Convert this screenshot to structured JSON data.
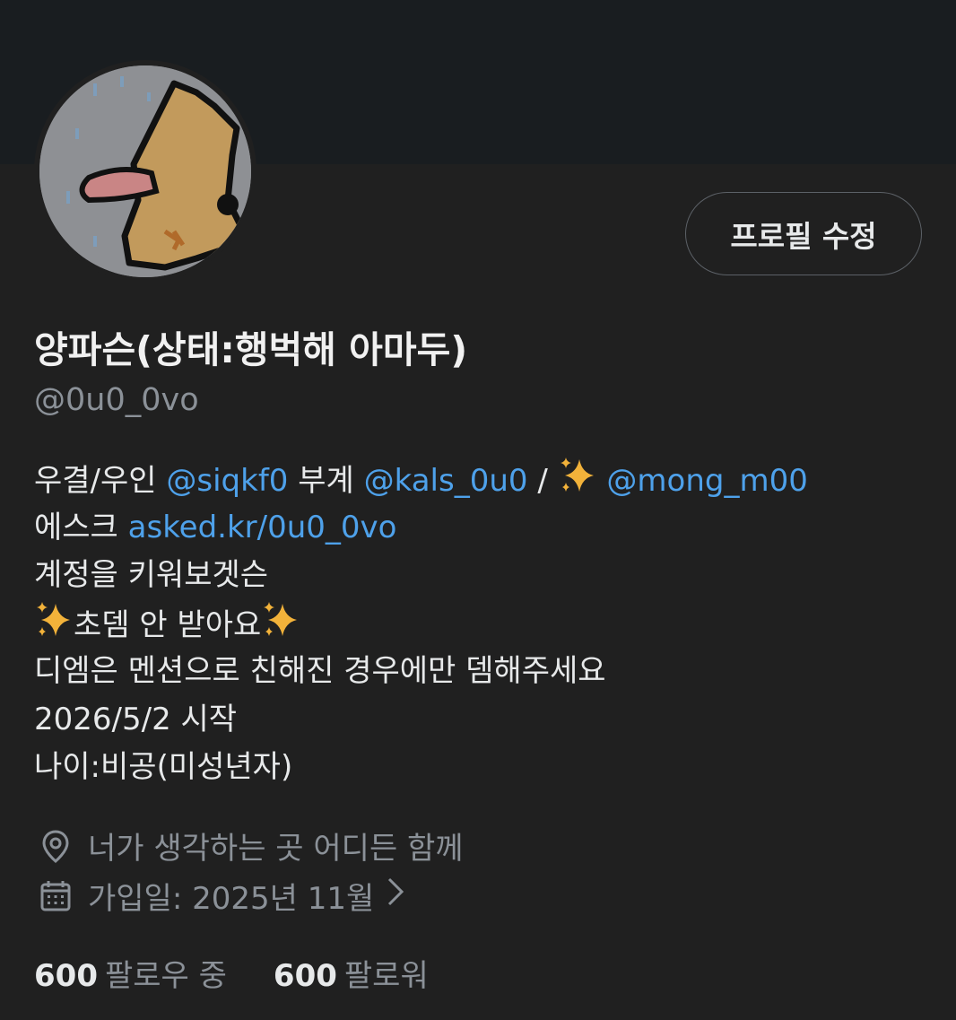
{
  "profile": {
    "display_name": "양파슨(상태:행벅해 아마두)",
    "handle": "@0u0_0vo",
    "edit_button": "프로필 수정",
    "bio": {
      "line1": {
        "prefix": "우결/우인 ",
        "mention1": "@siqkf0",
        "mid": "  부계 ",
        "mention2": "@kals_0u0",
        "sep": " / ",
        "mention3": "@mong_m00"
      },
      "line2": {
        "prefix": "에스크 ",
        "link": "asked.kr/0u0_0vo"
      },
      "line3": "계정을 키워보겟슨",
      "line4": "초뎀 안 받아요",
      "line5": "디엠은 멘션으로 친해진 경우에만 뎀해주세요",
      "line6": "2026/5/2 시작",
      "line7": "나이:비공(미성년자)"
    },
    "location": "너가 생각하는 곳 어디든 함께",
    "joined": "가입일: 2025년 11월",
    "following_count": "600",
    "following_label": "팔로우 중",
    "followers_count": "600",
    "followers_label": "팔로워"
  },
  "icons": {
    "location": "location-pin-icon",
    "calendar": "calendar-icon",
    "chevron": "chevron-right-icon",
    "sparkles": "sparkles-emoji"
  },
  "colors": {
    "background": "#202020",
    "banner": "#191d20",
    "link": "#4ea1ea",
    "secondary_text": "#8b9198",
    "primary_text": "#e7e9ea"
  }
}
